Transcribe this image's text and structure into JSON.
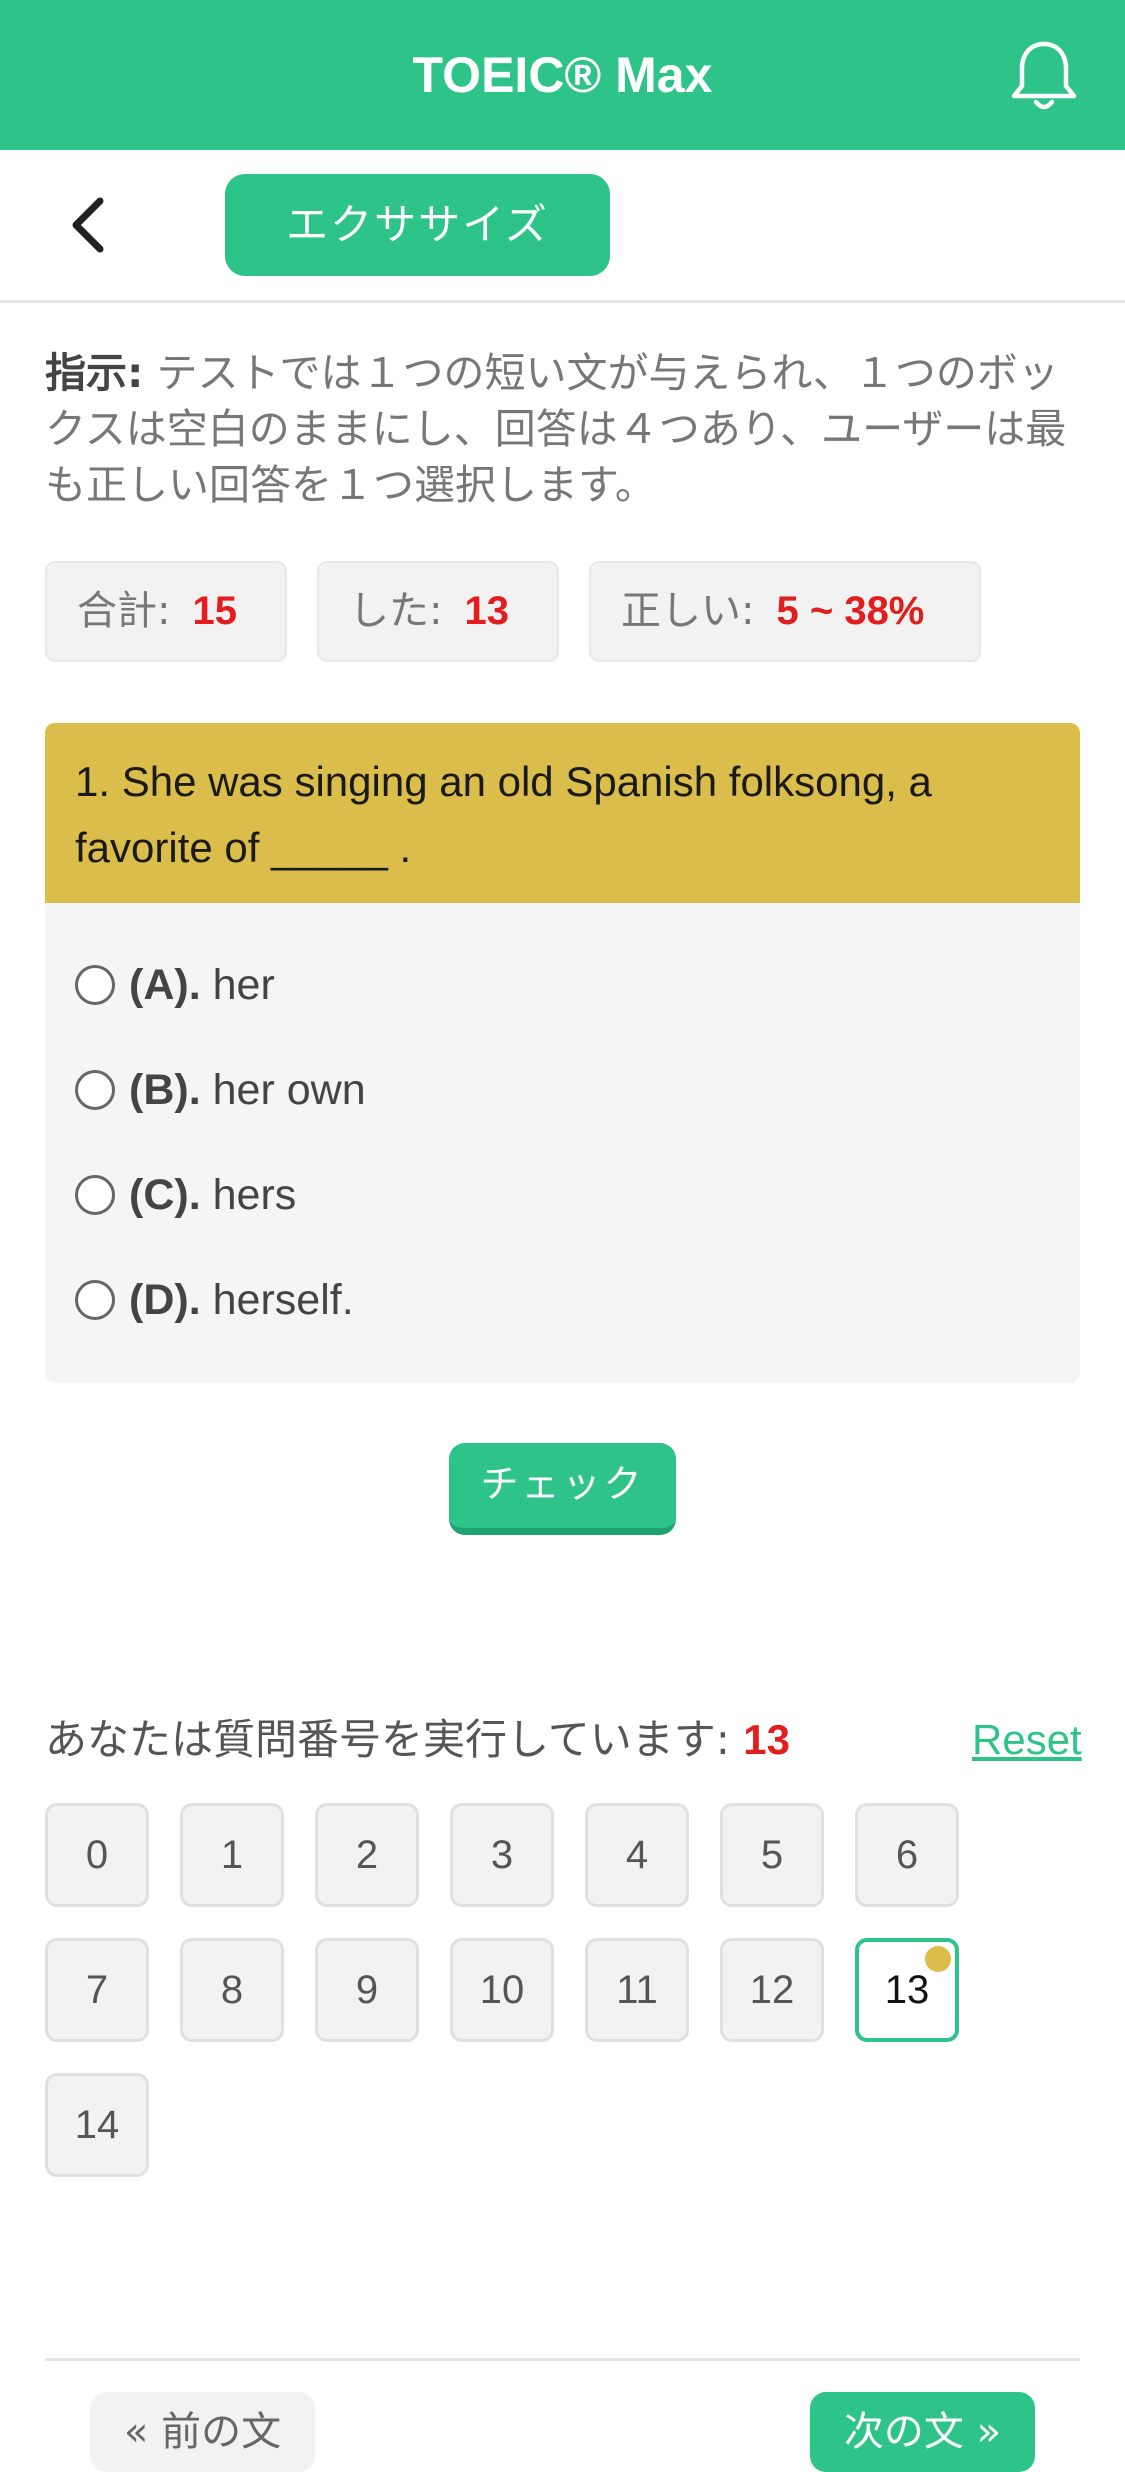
{
  "header": {
    "title": "TOEIC® Max",
    "notification_icon": "bell-icon"
  },
  "subnav": {
    "back_icon": "chevron-left-icon",
    "tab_label": "エクササイズ"
  },
  "instructions": {
    "label": "指示:",
    "text": " テストでは１つの短い文が与えられ、１つのボックスは空白のままにし、回答は４つあり、ユーザーは最も正しい回答を１つ選択します。"
  },
  "stats": {
    "total_label": "合計:",
    "total_value": "15",
    "done_label": "した:",
    "done_value": "13",
    "correct_label": "正しい:",
    "correct_value": "5 ~ 38%"
  },
  "question": {
    "text": "1. She was singing an old Spanish folksong, a favorite of _____ .",
    "options": [
      {
        "key": "(A).",
        "text": "her"
      },
      {
        "key": "(B).",
        "text": "her own"
      },
      {
        "key": "(C).",
        "text": "hers"
      },
      {
        "key": "(D).",
        "text": "herself."
      }
    ]
  },
  "check_button": "チェック",
  "progress": {
    "label": "あなたは質問番号を実行しています:",
    "current": "13",
    "reset": "Reset"
  },
  "question_numbers": [
    "0",
    "1",
    "2",
    "3",
    "4",
    "5",
    "6",
    "7",
    "8",
    "9",
    "10",
    "11",
    "12",
    "13",
    "14"
  ],
  "active_question": "13",
  "footer": {
    "prev": "« 前の文",
    "next": "次の文 »"
  },
  "colors": {
    "brand": "#2ec489",
    "question_bg": "#dbbd4b",
    "highlight": "#e11d1d"
  }
}
